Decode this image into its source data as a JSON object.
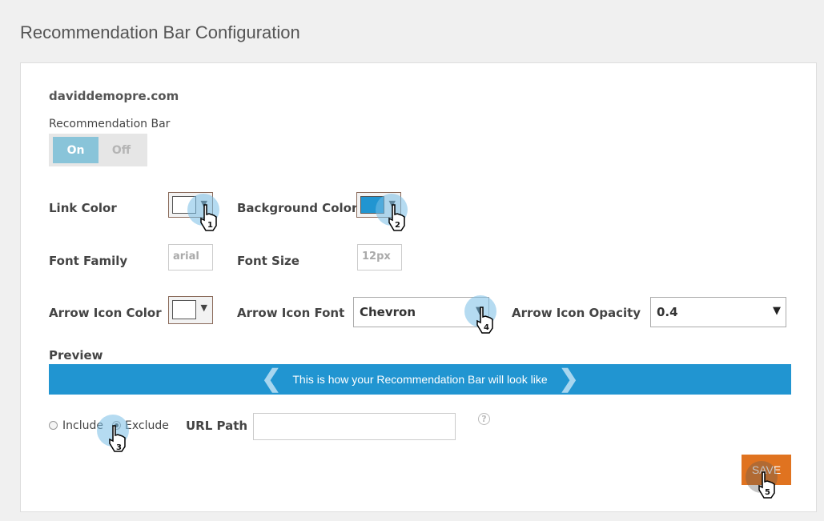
{
  "page": {
    "title": "Recommendation Bar Configuration"
  },
  "site": {
    "domain": "daviddemopre.com"
  },
  "recommendation_bar": {
    "label": "Recommendation Bar",
    "on_label": "On",
    "off_label": "Off",
    "state": "On"
  },
  "fields": {
    "link_color": {
      "label": "Link Color",
      "value": "#ffffff"
    },
    "background_color": {
      "label": "Background Color",
      "value": "#2195d1"
    },
    "font_family": {
      "label": "Font Family",
      "value": "arial"
    },
    "font_size": {
      "label": "Font Size",
      "value": "12px"
    },
    "arrow_icon_color": {
      "label": "Arrow Icon Color",
      "value": "#ffffff"
    },
    "arrow_icon_font": {
      "label": "Arrow Icon Font",
      "value": "Chevron"
    },
    "arrow_icon_opacity": {
      "label": "Arrow Icon Opacity",
      "value": "0.4"
    }
  },
  "preview": {
    "label": "Preview",
    "text": "This is how your Recommendation Bar will look like",
    "bar_color": "#2195d1"
  },
  "url_rule": {
    "include_label": "Include",
    "exclude_label": "Exclude",
    "selected": "Exclude",
    "path_label": "URL Path",
    "path_value": "",
    "help_icon": "?"
  },
  "actions": {
    "save_label": "SAVE",
    "save_color": "#e07320"
  },
  "tutorial_steps": [
    "1",
    "2",
    "3",
    "4",
    "5"
  ]
}
